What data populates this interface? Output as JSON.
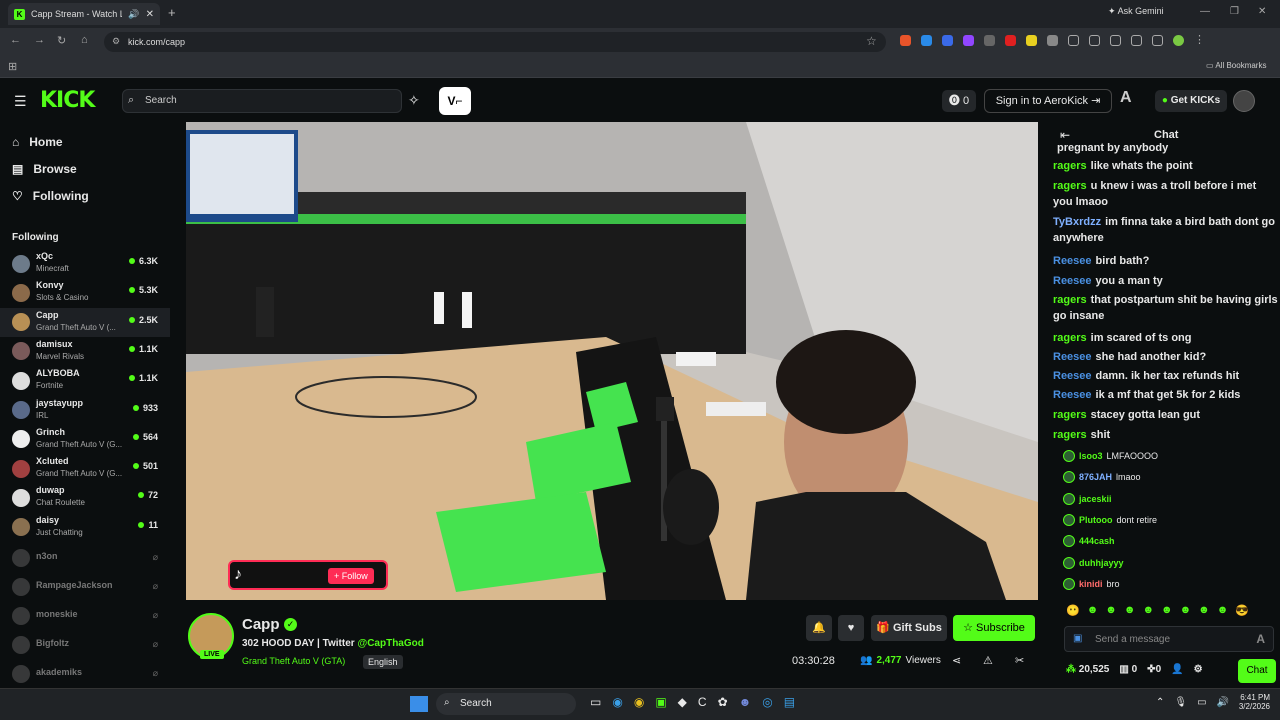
{
  "browser": {
    "tab_title": "Capp Stream - Watch Live ...",
    "url": "kick.com/capp",
    "gemini": "Ask Gemini",
    "all_bookmarks": "All Bookmarks"
  },
  "header": {
    "logo": "KICK",
    "search_placeholder": "Search",
    "notif_count": "0",
    "signin": "Sign in to AeroKick",
    "get_kicks": "Get KICKs"
  },
  "sidebar": {
    "nav": [
      {
        "label": "Home",
        "icon": "home-icon"
      },
      {
        "label": "Browse",
        "icon": "browse-icon"
      },
      {
        "label": "Following",
        "icon": "heart-icon"
      }
    ],
    "following_title": "Following",
    "channels": [
      {
        "name": "xQc",
        "game": "Minecraft",
        "viewers": "6.3K",
        "color": "#6d7b8a"
      },
      {
        "name": "Konvy",
        "game": "Slots & Casino",
        "viewers": "5.3K",
        "color": "#8b6a4a"
      },
      {
        "name": "Capp",
        "game": "Grand Theft Auto V (...",
        "viewers": "2.5K",
        "color": "#b89055"
      },
      {
        "name": "damisux",
        "game": "Marvel Rivals",
        "viewers": "1.1K",
        "color": "#7a5a5a"
      },
      {
        "name": "ALYBOBA",
        "game": "Fortnite",
        "viewers": "1.1K",
        "color": "#ddd"
      },
      {
        "name": "jaystayupp",
        "game": "IRL",
        "viewers": "933",
        "color": "#5a6a8a"
      },
      {
        "name": "Grinch",
        "game": "Grand Theft Auto V (G...",
        "viewers": "564",
        "color": "#eee"
      },
      {
        "name": "Xcluted",
        "game": "Grand Theft Auto V (G...",
        "viewers": "501",
        "color": "#a04040"
      },
      {
        "name": "duwap",
        "game": "Chat Roulette",
        "viewers": "72",
        "color": "#ddd"
      },
      {
        "name": "daisy",
        "game": "Just Chatting",
        "viewers": "11",
        "color": "#8a7050"
      }
    ],
    "offline": [
      "n3on",
      "RampageJackson",
      "moneskie",
      "Bigfoltz",
      "akademiks"
    ]
  },
  "video": {
    "overlay_follow": "+ Follow"
  },
  "stream": {
    "name": "Capp",
    "title_prefix": "302 HOOD DAY | Twitter",
    "twitter": "@CapThaGod",
    "game": "Grand Theft Auto V (GTA)",
    "language": "English",
    "live_badge": "LIVE",
    "duration": "03:30:28",
    "viewers": "2,477",
    "viewers_label": "Viewers",
    "gift_subs": "Gift Subs",
    "subscribe": "Subscribe"
  },
  "chat": {
    "title": "Chat",
    "messages": [
      {
        "user": "",
        "text": "pregnant by anybody",
        "color": "#53fc18"
      },
      {
        "user": "ragers",
        "text": "like whats the point",
        "color": "#53fc18"
      },
      {
        "user": "ragers",
        "text": "u knew i was a troll before i met you lmaoo",
        "color": "#53fc18"
      },
      {
        "user": "TyBxrdzz",
        "text": "im finna take a bird bath dont go anywhere",
        "color": "#7fb0ff"
      },
      {
        "user": "Reesee",
        "text": "bird bath?",
        "color": "#4a90e2"
      },
      {
        "user": "Reesee",
        "text": "you a man ty",
        "color": "#4a90e2"
      },
      {
        "user": "ragers",
        "text": "that postpartum shit be having girls go insane",
        "color": "#53fc18"
      },
      {
        "user": "ragers",
        "text": "im scared of ts ong",
        "color": "#53fc18"
      },
      {
        "user": "Reesee",
        "text": "she had another kid?",
        "color": "#4a90e2"
      },
      {
        "user": "Reesee",
        "text": "damn. ik her tax refunds hit",
        "color": "#4a90e2"
      },
      {
        "user": "Reesee",
        "text": "ik a mf that get 5k for 2 kids",
        "color": "#4a90e2"
      },
      {
        "user": "ragers",
        "text": "stacey gotta lean gut",
        "color": "#53fc18"
      },
      {
        "user": "ragers",
        "text": "shit",
        "color": "#53fc18"
      }
    ],
    "small_messages": [
      {
        "user": "lsoo3",
        "text": "LMFAOOOO",
        "color": "#53fc18"
      },
      {
        "user": "876JAH",
        "text": "lmaoo",
        "color": "#7fb0ff"
      },
      {
        "user": "jaceskii",
        "text": "",
        "color": "#53fc18"
      },
      {
        "user": "Plutooo",
        "text": "dont retire",
        "color": "#53fc18"
      },
      {
        "user": "444cash",
        "text": "",
        "color": "#53fc18"
      },
      {
        "user": "duhhjayyy",
        "text": "",
        "color": "#53fc18"
      },
      {
        "user": "kinidi",
        "text": "bro",
        "color": "#ff6b6b"
      }
    ],
    "input_placeholder": "Send a message",
    "kicks": "20,525",
    "zero1": "0",
    "zero2": "0",
    "chat_button": "Chat"
  },
  "taskbar": {
    "search": "Search",
    "time": "6:41 PM",
    "date": "3/2/2026"
  }
}
